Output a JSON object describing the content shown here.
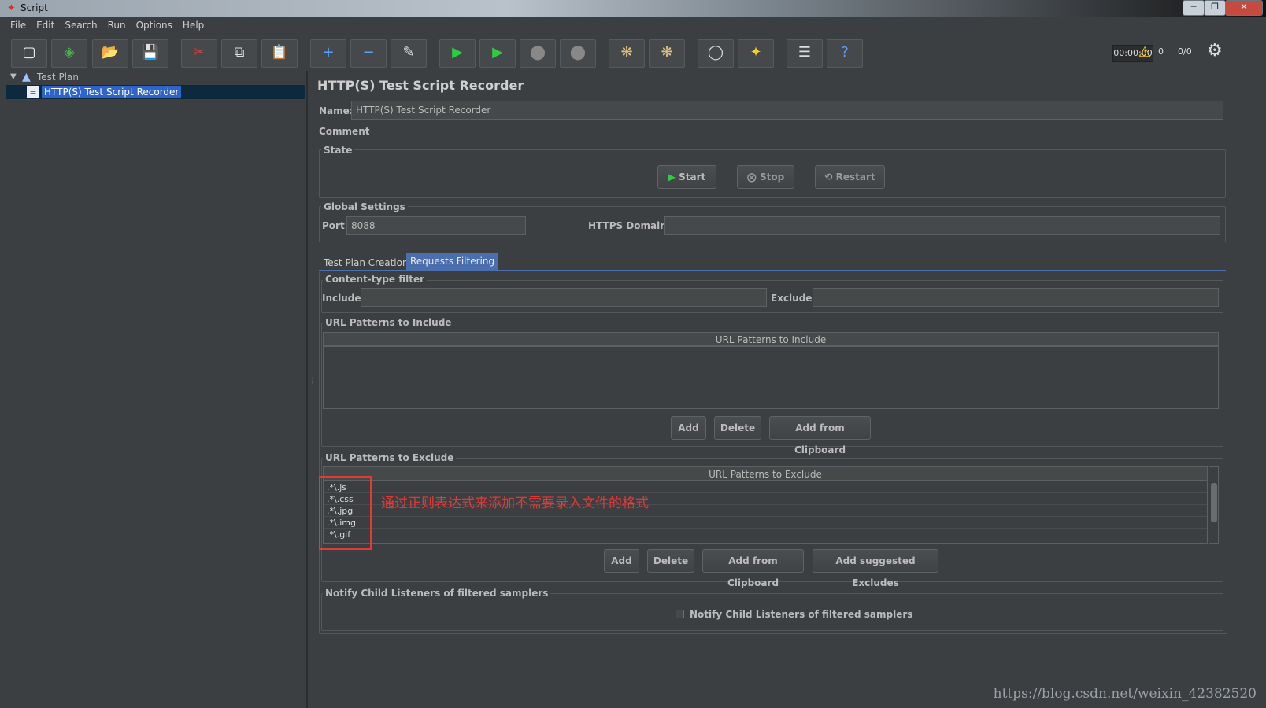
{
  "window": {
    "title": "Script"
  },
  "menu": [
    "File",
    "Edit",
    "Search",
    "Run",
    "Options",
    "Help"
  ],
  "toolbar": {
    "timer": "00:00:00",
    "warn_count": "0",
    "thread_count": "0/0"
  },
  "tree": {
    "root": "Test Plan",
    "child": "HTTP(S) Test Script Recorder"
  },
  "panel": {
    "title": "HTTP(S) Test Script Recorder",
    "name_label": "Name:",
    "name_value": "HTTP(S) Test Script Recorder",
    "comments_label": "Comments:",
    "state": {
      "label": "State",
      "start": "Start",
      "stop": "Stop",
      "restart": "Restart"
    },
    "global": {
      "label": "Global Settings",
      "port_label": "Port:",
      "port_value": "8088",
      "https_label": "HTTPS Domains:",
      "https_value": ""
    },
    "tabs": [
      "Test Plan Creation",
      "Requests Filtering"
    ],
    "content_filter": {
      "label": "Content-type filter",
      "include_label": "Include:",
      "exclude_label": "Exclude:"
    },
    "include_patterns": {
      "label": "URL Patterns to Include",
      "header": "URL Patterns to Include",
      "add": "Add",
      "delete": "Delete",
      "add_clip": "Add from Clipboard"
    },
    "exclude_patterns": {
      "label": "URL Patterns to Exclude",
      "header": "URL Patterns to Exclude",
      "rows": [
        ".*\\.js",
        ".*\\.css",
        ".*\\.jpg",
        ".*\\.img",
        ".*\\.gif"
      ],
      "add": "Add",
      "delete": "Delete",
      "add_clip": "Add from Clipboard",
      "add_suggested": "Add suggested Excludes"
    },
    "notify": {
      "label": "Notify Child Listeners of filtered samplers",
      "checkbox_label": "Notify Child Listeners of filtered samplers"
    }
  },
  "annotation": "通过正则表达式来添加不需要录入文件的格式",
  "watermark": "https://blog.csdn.net/weixin_42382520",
  "colors": {
    "background": "#3c3f41",
    "selection": "#2f65ca",
    "annotation_red": "#e53935",
    "green_play": "#2ecc40"
  }
}
